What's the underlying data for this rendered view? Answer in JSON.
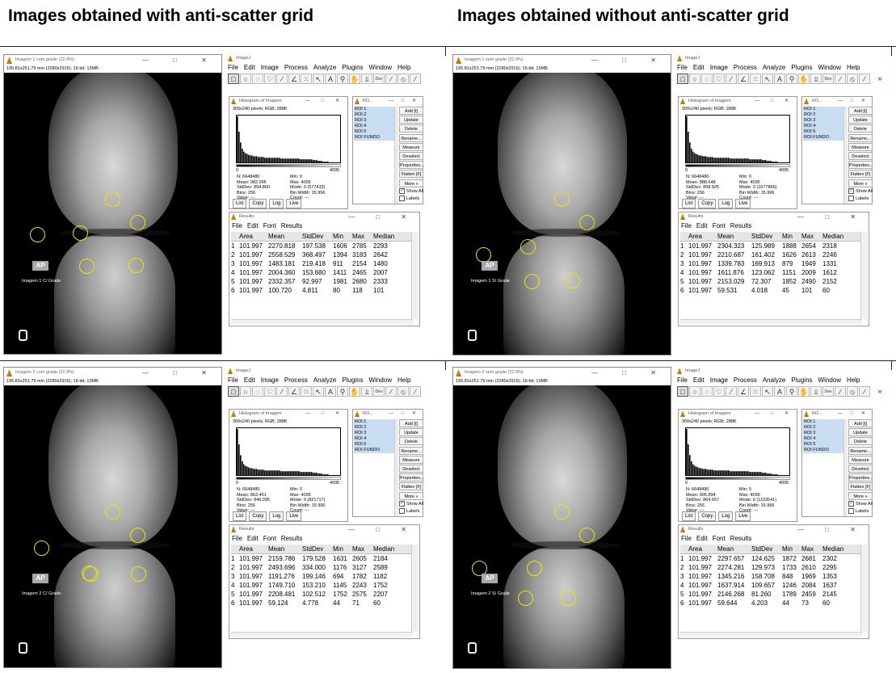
{
  "headings": {
    "left": "Images obtained with anti-scatter grid",
    "right": "Images obtained without anti-scatter grid"
  },
  "panels": [
    {
      "xray_title": "Imagem 1 com grade (22.9%)",
      "xray_info": "195.81x251.79 mm (2280x2916); 16-bit; 13MB",
      "image_label": "Imagem 1 C/ Grade",
      "stats": {
        "n": "N: 6648480",
        "min": "Min: 0",
        "mean": "Mean: 982.095",
        "max": "Max: 4095",
        "stddev": "StdDev: 894.860",
        "mode": "Mode: 0 (577433)",
        "bins": "Bins: 256",
        "binwidth": "Bin Width: 15.996",
        "value": "Value: ---",
        "count": "Count: ---"
      },
      "results": [
        [
          "1",
          "101.997",
          "2270.818",
          "197.538",
          "1606",
          "2785",
          "2293"
        ],
        [
          "2",
          "101.997",
          "2558.529",
          "368.497",
          "1394",
          "3183",
          "2642"
        ],
        [
          "3",
          "101.997",
          "1483.181",
          "219.418",
          "911",
          "2154",
          "1480"
        ],
        [
          "4",
          "101.997",
          "2004.360",
          "153.680",
          "1411",
          "2465",
          "2007"
        ],
        [
          "5",
          "101.997",
          "2332.357",
          "92.997",
          "1981",
          "2680",
          "2333"
        ],
        [
          "6",
          "101.997",
          "100.720",
          "4.811",
          "80",
          "118",
          "101"
        ]
      ]
    },
    {
      "xray_title": "Imagem 1 sem grade (22.9%)",
      "xray_info": "195.81x251.79 mm (2280x2916); 16-bit; 13MB",
      "image_label": "Imagem 1 S/ Grade",
      "stats": {
        "n": "N: 6648480",
        "min": "Min: 0",
        "mean": "Mean: 888.648",
        "max": "Max: 4095",
        "stddev": "StdDev: 858.925",
        "mode": "Mode: 0 (1077866)",
        "bins": "Bins: 256",
        "binwidth": "Bin Width: 15.996",
        "value": "Value: ---",
        "count": "Count: ---"
      },
      "results": [
        [
          "1",
          "101.997",
          "2304.323",
          "125.989",
          "1888",
          "2654",
          "2318"
        ],
        [
          "2",
          "101.997",
          "2210.687",
          "161.402",
          "1626",
          "2613",
          "2246"
        ],
        [
          "3",
          "101.997",
          "1339.783",
          "169.913",
          "879",
          "1949",
          "1331"
        ],
        [
          "4",
          "101.997",
          "1611.876",
          "123.062",
          "1151",
          "2009",
          "1612"
        ],
        [
          "5",
          "101.997",
          "2153.029",
          "72.307",
          "1852",
          "2490",
          "2152"
        ],
        [
          "6",
          "101.997",
          "59.531",
          "4.018",
          "45",
          "101",
          "60"
        ]
      ]
    },
    {
      "xray_title": "Imagem 2 com grade (22.9%)",
      "xray_info": "195.81x251.79 mm (2280x2916); 16-bit; 13MB",
      "image_label": "Imagem 2 C/ Grade",
      "stats": {
        "n": "N: 6648480",
        "min": "Min: 0",
        "mean": "Mean: 863.451",
        "max": "Max: 4095",
        "stddev": "StdDev: 846.095",
        "mode": "Mode: 0 (821717)",
        "bins": "Bins: 256",
        "binwidth": "Bin Width: 15.996",
        "value": "Value: ---",
        "count": "Count: ---"
      },
      "results": [
        [
          "1",
          "101.997",
          "2159.786",
          "179.528",
          "1631",
          "2605",
          "2184"
        ],
        [
          "2",
          "101.997",
          "2493.696",
          "334.000",
          "1176",
          "3127",
          "2589"
        ],
        [
          "3",
          "101.997",
          "1191.276",
          "199.146",
          "694",
          "1782",
          "1182"
        ],
        [
          "4",
          "101.997",
          "1749.710",
          "153.210",
          "1145",
          "2243",
          "1752"
        ],
        [
          "5",
          "101.997",
          "2208.481",
          "102.512",
          "1752",
          "2575",
          "2207"
        ],
        [
          "6",
          "101.997",
          "59.124",
          "4.778",
          "44",
          "71",
          "60"
        ]
      ]
    },
    {
      "xray_title": "Imagem 2 sem grade (22.9%)",
      "xray_info": "195.81x251.79 mm (2280x2916); 16-bit; 13MB",
      "image_label": "Imagem 2 S/ Grade",
      "stats": {
        "n": "N: 6648480",
        "min": "Min: 0",
        "mean": "Mean: 905.894",
        "max": "Max: 4095",
        "stddev": "StdDev: 864.657",
        "mode": "Mode: 0 (1103541)",
        "bins": "Bins: 256",
        "binwidth": "Bin Width: 15.996",
        "value": "Value: ---",
        "count": "Count: ---"
      },
      "results": [
        [
          "1",
          "101.997",
          "2297.657",
          "124.625",
          "1872",
          "2681",
          "2302"
        ],
        [
          "2",
          "101.997",
          "2274.281",
          "129.973",
          "1733",
          "2610",
          "2295"
        ],
        [
          "3",
          "101.997",
          "1345.216",
          "158.708",
          "848",
          "1969",
          "1353"
        ],
        [
          "4",
          "101.997",
          "1637.914",
          "109.657",
          "1246",
          "2084",
          "1637"
        ],
        [
          "5",
          "101.997",
          "2146.268",
          "81.260",
          "1789",
          "2459",
          "2145"
        ],
        [
          "6",
          "101.997",
          "59.644",
          "4.203",
          "44",
          "73",
          "60"
        ]
      ]
    }
  ],
  "common": {
    "ap_label": "AP",
    "imagej_title": "ImageJ",
    "menus": [
      "File",
      "Edit",
      "Image",
      "Process",
      "Analyze",
      "Plugins",
      "Window",
      "Help"
    ],
    "tools": [
      "□",
      "○",
      "◌",
      "♡",
      "⁄",
      "∠",
      "⁙",
      "↖",
      "A",
      "⚲",
      "✋",
      "⫫",
      "Dev",
      "∕",
      "⦸",
      "⁄"
    ],
    "hist_title": "Histogram of Imagem",
    "hist_meta": "300x240 pixels; RGB; 288K",
    "hist_axis_min": "0",
    "hist_axis_max": "4095",
    "hist_buttons": [
      "List",
      "Copy",
      "Log",
      "Live"
    ],
    "roi_title": "RO...",
    "roi_items": [
      "ROI 1",
      "ROI 2",
      "ROI 3",
      "ROI 4",
      "ROI 5",
      "ROI FUNDO"
    ],
    "roi_buttons": [
      "Add [t]",
      "Update",
      "Delete",
      "Rename...",
      "Measure",
      "Deselect",
      "Properties...",
      "Flatten [F]",
      "More »"
    ],
    "roi_show_all": "Show All",
    "roi_labels": "Labels",
    "results_title": "Results",
    "results_menu": [
      "File",
      "Edit",
      "Font",
      "Results"
    ],
    "results_headers": [
      "",
      "Area",
      "Mean",
      "StdDev",
      "Min",
      "Max",
      "Median"
    ],
    "window_buttons": "— □ ✕",
    "colors": {
      "roi_circle": "#e9e700",
      "roi_highlight": "#c9ddf2",
      "toolbar_arrow": "#d03010"
    }
  }
}
